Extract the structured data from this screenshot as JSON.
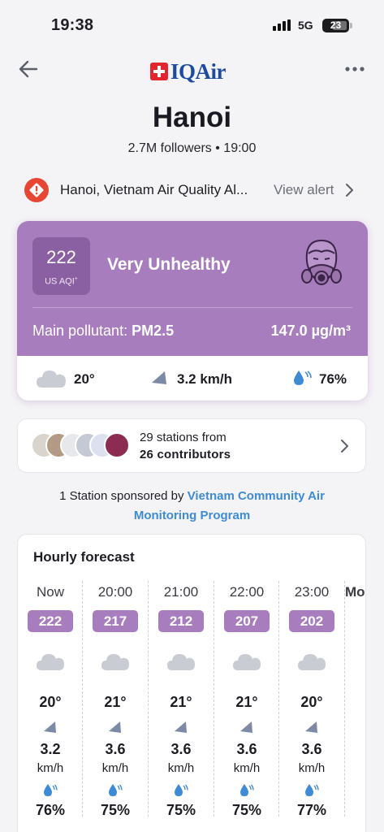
{
  "status_bar": {
    "time": "19:38",
    "network": "5G",
    "battery": "23"
  },
  "header": {
    "logo_text": "IQAir"
  },
  "city": {
    "name": "Hanoi",
    "followers": "2.7M followers • 19:00"
  },
  "alert": {
    "text": "Hanoi, Vietnam Air Quality Al...",
    "action": "View alert"
  },
  "aqi": {
    "value": "222",
    "unit": "US AQI",
    "unit_sup": "+",
    "level": "Very Unhealthy",
    "pollutant_label": "Main pollutant: ",
    "pollutant": "PM2.5",
    "concentration": "147.0 µg/m³",
    "color": "#a77dbe",
    "color_dark": "#8a60a2"
  },
  "current_weather": {
    "temp": "20°",
    "wind": "3.2 km/h",
    "humidity": "76%"
  },
  "stations": {
    "line1": "29 stations from",
    "line2": "26 contributors"
  },
  "sponsor": {
    "prefix": "1 Station sponsored by ",
    "name": "Vietnam Community Air Monitoring Program"
  },
  "forecast": {
    "title": "Hourly forecast",
    "hours": [
      {
        "time": "Now",
        "aqi": "222",
        "temp": "20°",
        "wind": "3.2",
        "wind_unit": "km/h",
        "humidity": "76%"
      },
      {
        "time": "20:00",
        "aqi": "217",
        "temp": "21°",
        "wind": "3.6",
        "wind_unit": "km/h",
        "humidity": "75%"
      },
      {
        "time": "21:00",
        "aqi": "212",
        "temp": "21°",
        "wind": "3.6",
        "wind_unit": "km/h",
        "humidity": "75%"
      },
      {
        "time": "22:00",
        "aqi": "207",
        "temp": "21°",
        "wind": "3.6",
        "wind_unit": "km/h",
        "humidity": "75%"
      },
      {
        "time": "23:00",
        "aqi": "202",
        "temp": "20°",
        "wind": "3.6",
        "wind_unit": "km/h",
        "humidity": "77%"
      }
    ],
    "next_label": "Mo"
  },
  "icons": [
    "back-arrow-icon",
    "more-dots-icon",
    "alert-icon",
    "gas-mask-icon",
    "cloud-icon",
    "wind-icon",
    "humidity-icon",
    "chevron-right-icon"
  ]
}
